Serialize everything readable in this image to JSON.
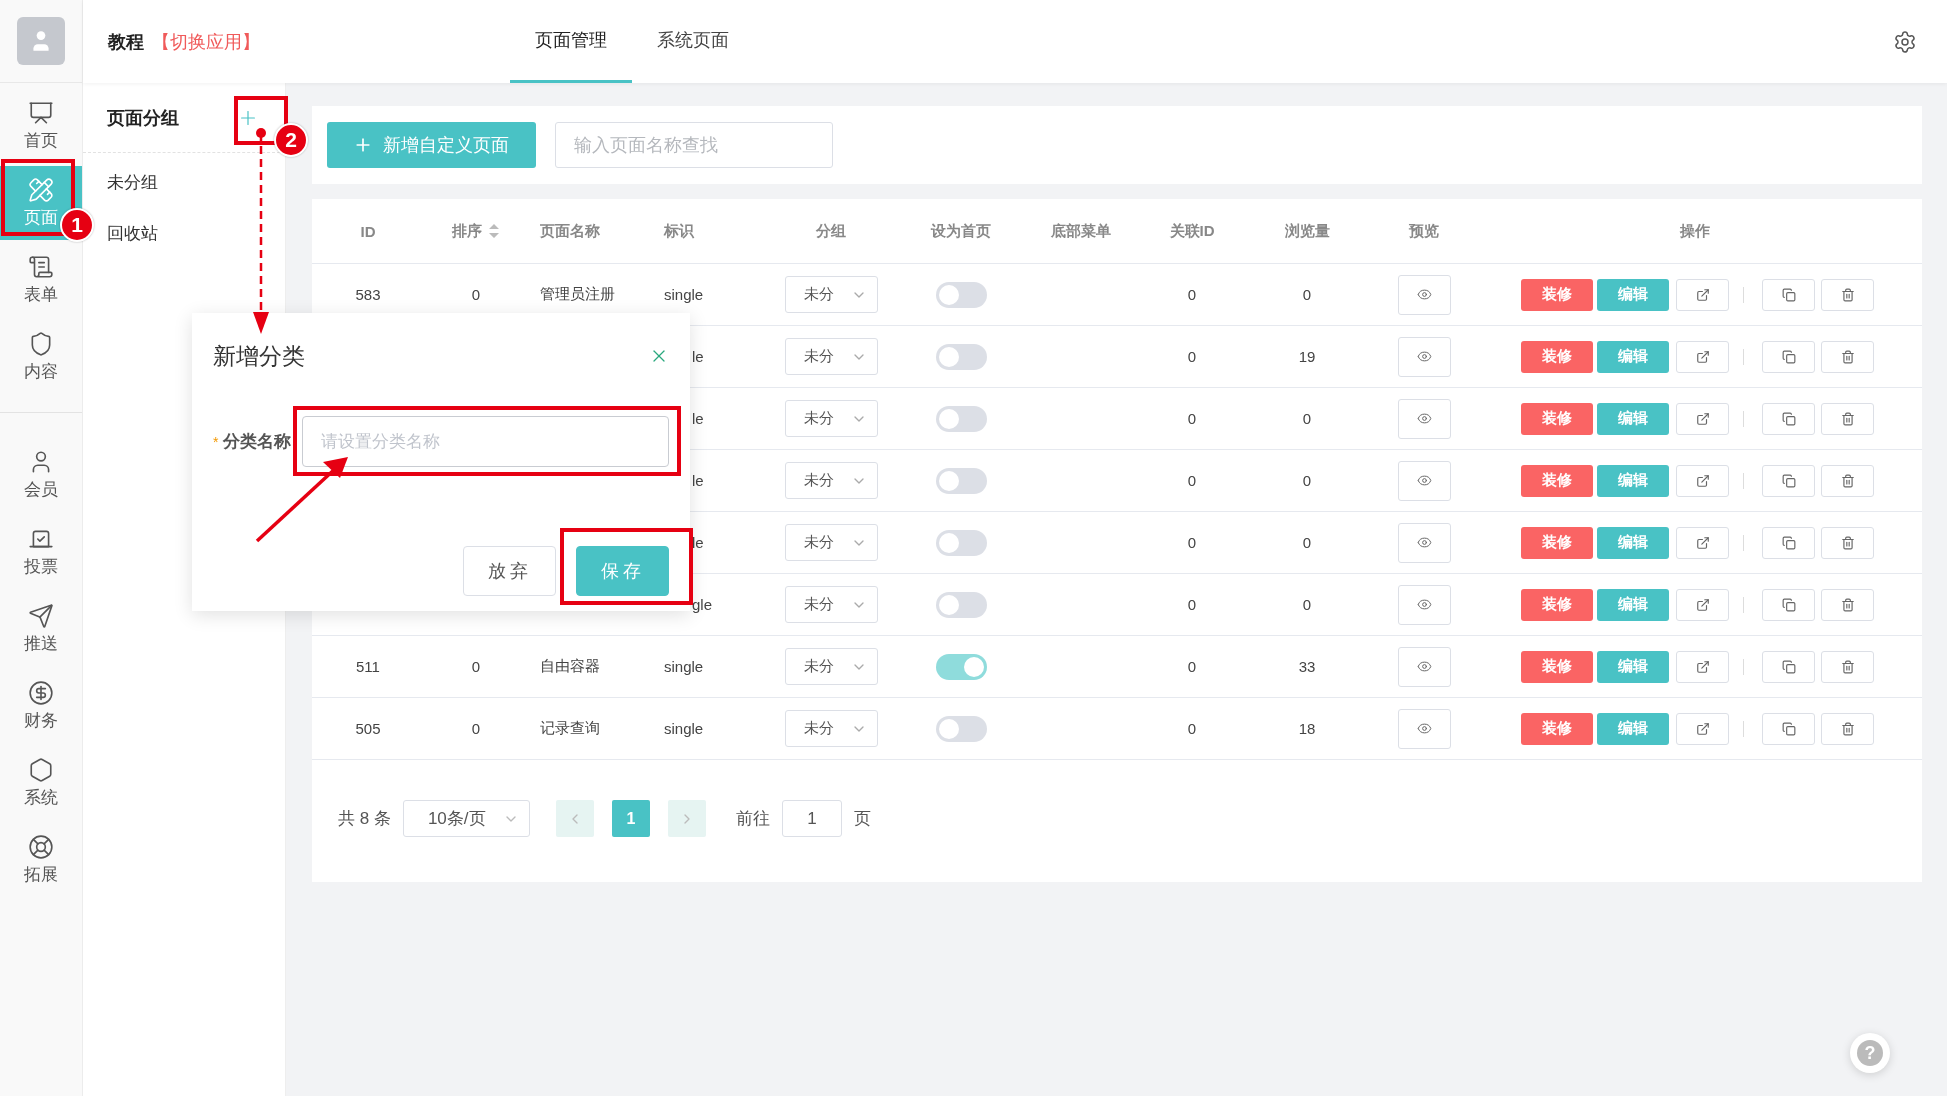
{
  "app": {
    "name": "教程",
    "switch_link": "【切换应用】"
  },
  "nav_top": [
    {
      "label": "首页",
      "selected": false
    },
    {
      "label": "页面",
      "selected": true
    },
    {
      "label": "表单",
      "selected": false
    },
    {
      "label": "内容",
      "selected": false
    }
  ],
  "nav_bottom": [
    {
      "label": "会员",
      "selected": false
    },
    {
      "label": "投票",
      "selected": false
    },
    {
      "label": "推送",
      "selected": false
    },
    {
      "label": "财务",
      "selected": false
    },
    {
      "label": "系统",
      "selected": false
    },
    {
      "label": "拓展",
      "selected": false
    }
  ],
  "tabs": [
    {
      "label": "页面管理",
      "selected": true
    },
    {
      "label": "系统页面",
      "selected": false
    }
  ],
  "groups_panel": {
    "title": "页面分组",
    "items": [
      "未分组",
      "回收站"
    ]
  },
  "toolbar": {
    "add_button": "新增自定义页面",
    "search": {
      "placeholder": "输入页面名称查找"
    }
  },
  "table": {
    "columns": [
      "ID",
      "排序",
      "页面名称",
      "标识",
      "分组",
      "设为首页",
      "底部菜单",
      "关联ID",
      "浏览量",
      "预览",
      "操作"
    ],
    "rows": [
      {
        "id": "583",
        "sort": "0",
        "name": "管理员注册",
        "tag": "single",
        "group": "未分",
        "home": false,
        "link_id": "0",
        "views": "0",
        "actions": [
          "装修",
          "编辑"
        ]
      },
      {
        "tag": "le",
        "group": "未分",
        "home": false,
        "link_id": "0",
        "views": "19",
        "actions": [
          "装修",
          "编辑"
        ]
      },
      {
        "tag": "le",
        "group": "未分",
        "home": false,
        "link_id": "0",
        "views": "0",
        "actions": [
          "装修",
          "编辑"
        ]
      },
      {
        "tag": "le",
        "group": "未分",
        "home": false,
        "link_id": "0",
        "views": "0",
        "actions": [
          "装修",
          "编辑"
        ]
      },
      {
        "tag": "le",
        "group": "未分",
        "home": false,
        "link_id": "0",
        "views": "0",
        "actions": [
          "装修",
          "编辑"
        ]
      },
      {
        "tag": "gle",
        "group": "未分",
        "home": false,
        "link_id": "0",
        "views": "0",
        "actions": [
          "装修",
          "编辑"
        ]
      },
      {
        "id": "511",
        "sort": "0",
        "name": "自由容器",
        "tag": "single",
        "group": "未分",
        "home": true,
        "link_id": "0",
        "views": "33",
        "actions": [
          "装修",
          "编辑"
        ]
      },
      {
        "id": "505",
        "sort": "0",
        "name": "记录查询",
        "tag": "single",
        "group": "未分",
        "home": false,
        "link_id": "0",
        "views": "18",
        "actions": [
          "装修",
          "编辑"
        ]
      }
    ]
  },
  "pagination": {
    "total": "共 8 条",
    "page_size": "10条/页",
    "page": "1",
    "goto_label": "前往",
    "goto_value": "1",
    "goto_suffix": "页"
  },
  "dialog": {
    "title": "新增分类",
    "field_label": "分类名称",
    "required_mark": "*",
    "placeholder": "请设置分类名称",
    "buttons": [
      "放弃",
      "保存"
    ]
  },
  "annotations": {
    "badges": [
      "1",
      "2"
    ]
  },
  "help": "?"
}
